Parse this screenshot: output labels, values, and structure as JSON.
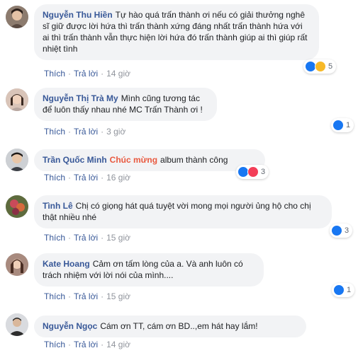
{
  "comments": [
    {
      "name": "Nguyễn Thu Hiền",
      "text": "Tự hào quá trấn thành ơi nếu có giải thưởng nghê sĩ giữ được lời hứa thì trấn thành xứng đáng nhất trấn thành hứa với ai thì trấn thành vẫn thực hiện lời hứa đó trấn thành giúp ai thì giúp rất nhiệt tình",
      "like": "Thích",
      "reply": "Trả lời",
      "time": "14 giờ",
      "reaction_count": "5",
      "reaction_icons": [
        "like-icon",
        "haha-icon"
      ]
    },
    {
      "name": "Nguyễn Thị Trà My",
      "text": "Mình cũng tương tác để luôn thấy nhau nhé MC Trấn Thành ơi !",
      "like": "Thích",
      "reply": "Trả lời",
      "time": "3 giờ",
      "reaction_count": "1",
      "reaction_icons": [
        "like-icon"
      ]
    },
    {
      "name": "Trần Quốc Minh",
      "highlight": "Chúc mừng",
      "text": "album thành công",
      "like": "Thích",
      "reply": "Trả lời",
      "time": "16 giờ",
      "reaction_count": "3",
      "reaction_icons": [
        "like-icon",
        "love-icon"
      ]
    },
    {
      "name": "Tình Lê",
      "text": "Chị có giọng hát quá tuyệt vời mong mọi người ủng hộ cho chị thật nhiều nhé",
      "like": "Thích",
      "reply": "Trả lời",
      "time": "15 giờ",
      "reaction_count": "3",
      "reaction_icons": [
        "like-icon"
      ]
    },
    {
      "name": "Kate Hoang",
      "text": "Cảm ơn tấm lòng của a. Và anh luôn có trách nhiệm với lời nói của mình....",
      "like": "Thích",
      "reply": "Trả lời",
      "time": "15 giờ",
      "reaction_count": "1",
      "reaction_icons": [
        "like-icon"
      ]
    },
    {
      "name": "Nguyễn Ngọc",
      "text": "Cám ơn TT, cám ơn BD..,em hát hay lắm!",
      "like": "Thích",
      "reply": "Trả lời",
      "time": "14 giờ"
    }
  ],
  "colors": {
    "name": "#385898",
    "bubble": "#f2f3f5",
    "highlight": "#e9593f",
    "like": "#1877f2",
    "love": "#f33e58",
    "haha": "#f7b928"
  }
}
